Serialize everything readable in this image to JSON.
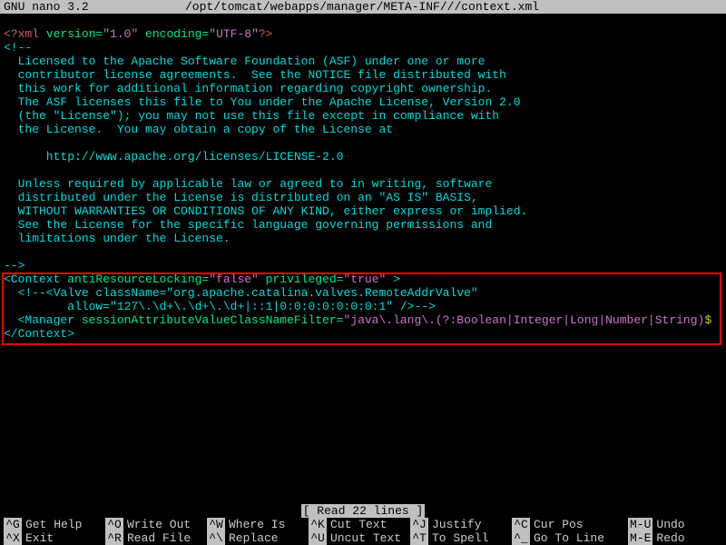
{
  "titlebar": {
    "app": "GNU nano 3.2",
    "path": "/opt/tomcat/webapps/manager/META-INF///context.xml"
  },
  "xml": {
    "decl_open": "<?xml",
    "decl_attrs": " version=",
    "decl_v": "\"1.0\"",
    "decl_enc_attr": " encoding=",
    "decl_enc_v": "\"UTF-8\"",
    "decl_close": "?>",
    "comment_open": "<!--",
    "license": [
      "  Licensed to the Apache Software Foundation (ASF) under one or more",
      "  contributor license agreements.  See the NOTICE file distributed with",
      "  this work for additional information regarding copyright ownership.",
      "  The ASF licenses this file to You under the Apache License, Version 2.0",
      "  (the \"License\"); you may not use this file except in compliance with",
      "  the License.  You may obtain a copy of the License at",
      "",
      "      http://www.apache.org/licenses/LICENSE-2.0",
      "",
      "  Unless required by applicable law or agreed to in writing, software",
      "  distributed under the License is distributed on an \"AS IS\" BASIS,",
      "  WITHOUT WARRANTIES OR CONDITIONS OF ANY KIND, either express or implied.",
      "  See the License for the specific language governing permissions and",
      "  limitations under the License."
    ],
    "comment_close": "-->",
    "ctx_open": "<Context",
    "ctx_attr1": " antiResourceLocking=",
    "ctx_val1": "\"false\"",
    "ctx_attr2": " privileged=",
    "ctx_val2": "\"true\"",
    "ctx_gt": " >",
    "valve1": "  <!--<Valve className=\"org.apache.catalina.valves.RemoteAddrValve\"",
    "valve2": "         allow=\"127\\.\\d+\\.\\d+\\.\\d+|::1|0:0:0:0:0:0:0:1\" />-->",
    "mgr_open": "  <Manager",
    "mgr_attr": " sessionAttributeValueClassNameFilter=",
    "mgr_val": "\"java\\.lang\\.(?:Boolean|Integer|Long|Number|String)",
    "mgr_cont": "$",
    "ctx_close": "</Context>"
  },
  "status": "[ Read 22 lines ]",
  "shortcuts": [
    {
      "key": "^G",
      "label": "Get Help"
    },
    {
      "key": "^O",
      "label": "Write Out"
    },
    {
      "key": "^W",
      "label": "Where Is"
    },
    {
      "key": "^K",
      "label": "Cut Text"
    },
    {
      "key": "^J",
      "label": "Justify"
    },
    {
      "key": "^C",
      "label": "Cur Pos"
    },
    {
      "key": "M-U",
      "label": "Undo"
    },
    {
      "key": "^X",
      "label": "Exit"
    },
    {
      "key": "^R",
      "label": "Read File"
    },
    {
      "key": "^\\",
      "label": "Replace"
    },
    {
      "key": "^U",
      "label": "Uncut Text"
    },
    {
      "key": "^T",
      "label": "To Spell"
    },
    {
      "key": "^_",
      "label": "Go To Line"
    },
    {
      "key": "M-E",
      "label": "Redo"
    }
  ]
}
